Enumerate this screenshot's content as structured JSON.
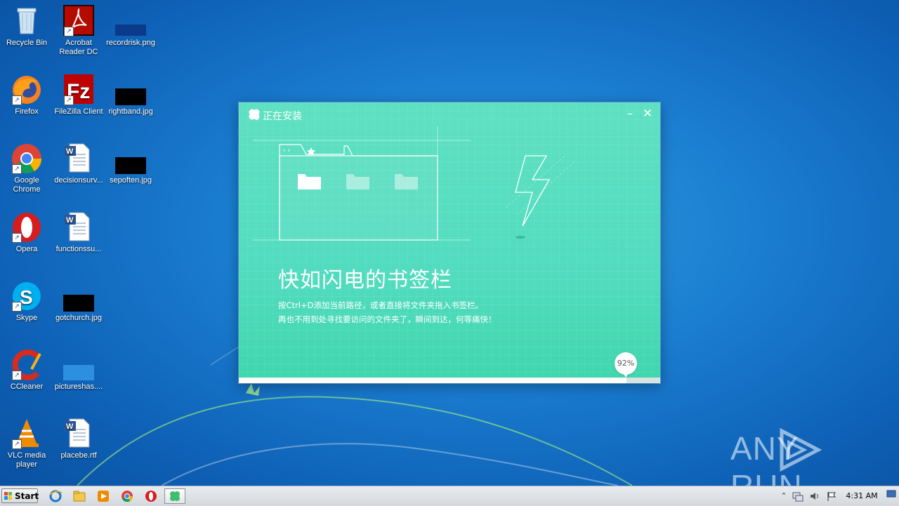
{
  "desktop_icons": [
    {
      "label": "Recycle Bin"
    },
    {
      "label": "Acrobat Reader DC"
    },
    {
      "label": "recordrisk.png"
    },
    {
      "label": "Firefox"
    },
    {
      "label": "FileZilla Client"
    },
    {
      "label": "rightband.jpg"
    },
    {
      "label": "Google Chrome"
    },
    {
      "label": "decisionsurv..."
    },
    {
      "label": "sepoften.jpg"
    },
    {
      "label": "Opera"
    },
    {
      "label": "functionssu..."
    },
    {
      "label": "Skype"
    },
    {
      "label": "gotchurch.jpg"
    },
    {
      "label": "CCleaner"
    },
    {
      "label": "pictureshas...."
    },
    {
      "label": "VLC media player"
    },
    {
      "label": "placebe.rtf"
    }
  ],
  "installer": {
    "title": "正在安装",
    "headline": "快如闪电的书签栏",
    "desc_line1": "按Ctrl+D添加当前路径，或者直接将文件夹拖入书签栏。",
    "desc_line2": "再也不用到处寻找要访问的文件夹了，瞬间到达，何等痛快！",
    "progress_text": "92%",
    "progress_value": 92,
    "accent_color": "#52dcbf"
  },
  "watermark": {
    "left": "ANY",
    "right": "RUN"
  },
  "taskbar": {
    "start_label": "Start",
    "clock": "4:31 AM"
  }
}
